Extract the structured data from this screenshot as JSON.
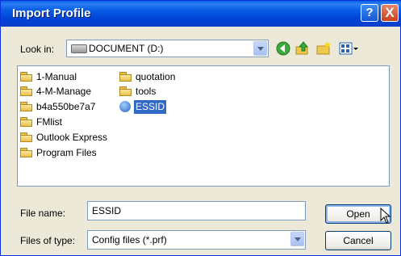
{
  "dialog": {
    "title": "Import Profile",
    "help_symbol": "?",
    "close_symbol": "X"
  },
  "lookin": {
    "label": "Look in:",
    "value": "DOCUMENT (D:)"
  },
  "files": {
    "col1": [
      "1-Manual",
      "4-M-Manage",
      "b4a550be7a7",
      "FMlist",
      "Outlook Express",
      "Program Files"
    ],
    "col2": [
      "quotation",
      "tools",
      "ESSID"
    ],
    "selected": "ESSID"
  },
  "file_name": {
    "label": "File name:",
    "value": "ESSID"
  },
  "files_of_type": {
    "label": "Files of type:",
    "value": "Config files (*.prf)"
  },
  "buttons": {
    "open": "Open",
    "cancel": "Cancel"
  },
  "colors": {
    "titlebar": "#0a5fe6",
    "selection": "#316ac5",
    "dialog_bg": "#ece9d8"
  }
}
